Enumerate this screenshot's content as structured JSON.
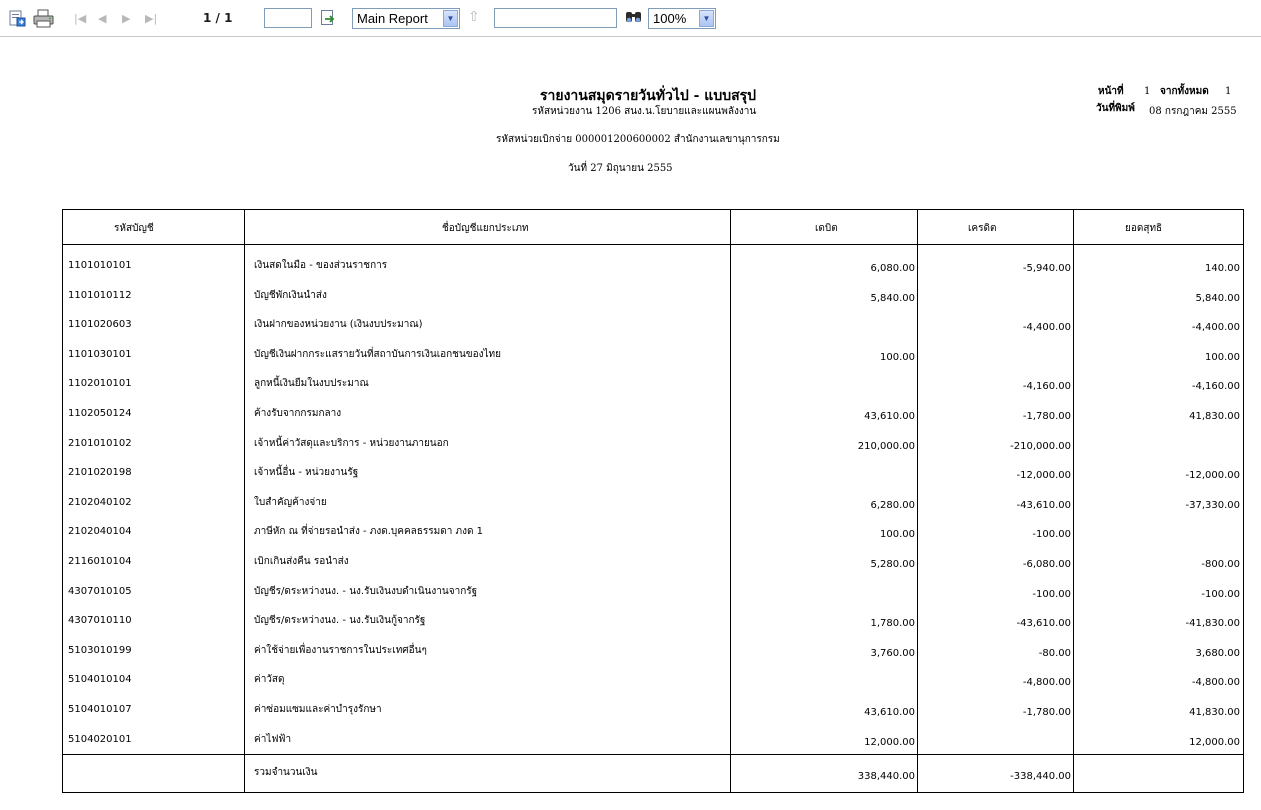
{
  "toolbar": {
    "page_info": "1 / 1",
    "goto_value": "",
    "report_select": "Main Report",
    "search_value": "",
    "zoom": "100%"
  },
  "report": {
    "title": "รายงานสมุดรายวันทั่วไป - แบบสรุป",
    "subtitle1": "รหัสหน่วยงาน 1206 สนง.น.โยบายและแผนพลังงาน",
    "subtitle2": "รหัสหน่วยเบิกจ่าย 000001200600002 สำนักงานเลขานุการกรม",
    "subtitle3": "วันที่ 27 มิถุนายน 2555",
    "page_label": "หน้าที่",
    "page_number": "1",
    "total_label": "จากทั้งหมด",
    "total_pages": "1",
    "print_date_label": "วันที่พิมพ์",
    "print_date": "08 กรกฎาคม 2555"
  },
  "table": {
    "headers": [
      "รหัสบัญชี",
      "ชื่อบัญชีแยกประเภท",
      "เดบิต",
      "เครดิต",
      "ยอดสุทธิ"
    ],
    "rows": [
      {
        "code": "1101010101",
        "name": "เงินสดในมือ - ของส่วนราชการ",
        "debit": "6,080.00",
        "credit": "-5,940.00",
        "net": "140.00"
      },
      {
        "code": "1101010112",
        "name": "บัญชีพักเงินนำส่ง",
        "debit": "5,840.00",
        "credit": "",
        "net": "5,840.00"
      },
      {
        "code": "1101020603",
        "name": "เงินฝากของหน่วยงาน (เงินงบประมาณ)",
        "debit": "",
        "credit": "-4,400.00",
        "net": "-4,400.00"
      },
      {
        "code": "1101030101",
        "name": "บัญชีเงินฝากกระแสรายวันที่สถาบันการเงินเอกชนของไทย",
        "debit": "100.00",
        "credit": "",
        "net": "100.00"
      },
      {
        "code": "1102010101",
        "name": "ลูกหนี้เงินยืมในงบประมาณ",
        "debit": "",
        "credit": "-4,160.00",
        "net": "-4,160.00"
      },
      {
        "code": "1102050124",
        "name": "ค้างรับจากกรมกลาง",
        "debit": "43,610.00",
        "credit": "-1,780.00",
        "net": "41,830.00"
      },
      {
        "code": "2101010102",
        "name": "เจ้าหนี้ค่าวัสดุและบริการ - หน่วยงานภายนอก",
        "debit": "210,000.00",
        "credit": "-210,000.00",
        "net": ""
      },
      {
        "code": "2101020198",
        "name": "เจ้าหนี้อื่น - หน่วยงานรัฐ",
        "debit": "",
        "credit": "-12,000.00",
        "net": "-12,000.00"
      },
      {
        "code": "2102040102",
        "name": "ใบสำคัญค้างจ่าย",
        "debit": "6,280.00",
        "credit": "-43,610.00",
        "net": "-37,330.00"
      },
      {
        "code": "2102040104",
        "name": "ภาษีหัก ณ ที่จ่ายรอนำส่ง - ภงด.บุคคลธรรมดา ภงด 1",
        "debit": "100.00",
        "credit": "-100.00",
        "net": ""
      },
      {
        "code": "2116010104",
        "name": "เบิกเกินส่งคืน รอนำส่ง",
        "debit": "5,280.00",
        "credit": "-6,080.00",
        "net": "-800.00"
      },
      {
        "code": "4307010105",
        "name": "บัญชีร/ดระหว่างนง. - นง.รับเงินงบดำเนินงานจากรัฐ",
        "debit": "",
        "credit": "-100.00",
        "net": "-100.00"
      },
      {
        "code": "4307010110",
        "name": "บัญชีร/ดระหว่างนง. - นง.รับเงินกู้จากรัฐ",
        "debit": "1,780.00",
        "credit": "-43,610.00",
        "net": "-41,830.00"
      },
      {
        "code": "5103010199",
        "name": "ค่าใช้จ่ายเพื่องานราชการในประเทศอื่นๆ",
        "debit": "3,760.00",
        "credit": "-80.00",
        "net": "3,680.00"
      },
      {
        "code": "5104010104",
        "name": "ค่าวัสดุ",
        "debit": "",
        "credit": "-4,800.00",
        "net": "-4,800.00"
      },
      {
        "code": "5104010107",
        "name": "ค่าซ่อมแซมและค่าบำรุงรักษา",
        "debit": "43,610.00",
        "credit": "-1,780.00",
        "net": "41,830.00"
      },
      {
        "code": "5104020101",
        "name": "ค่าไฟฟ้า",
        "debit": "12,000.00",
        "credit": "",
        "net": "12,000.00"
      }
    ],
    "total": {
      "label": "รวมจำนวนเงิน",
      "debit": "338,440.00",
      "credit": "-338,440.00"
    }
  }
}
